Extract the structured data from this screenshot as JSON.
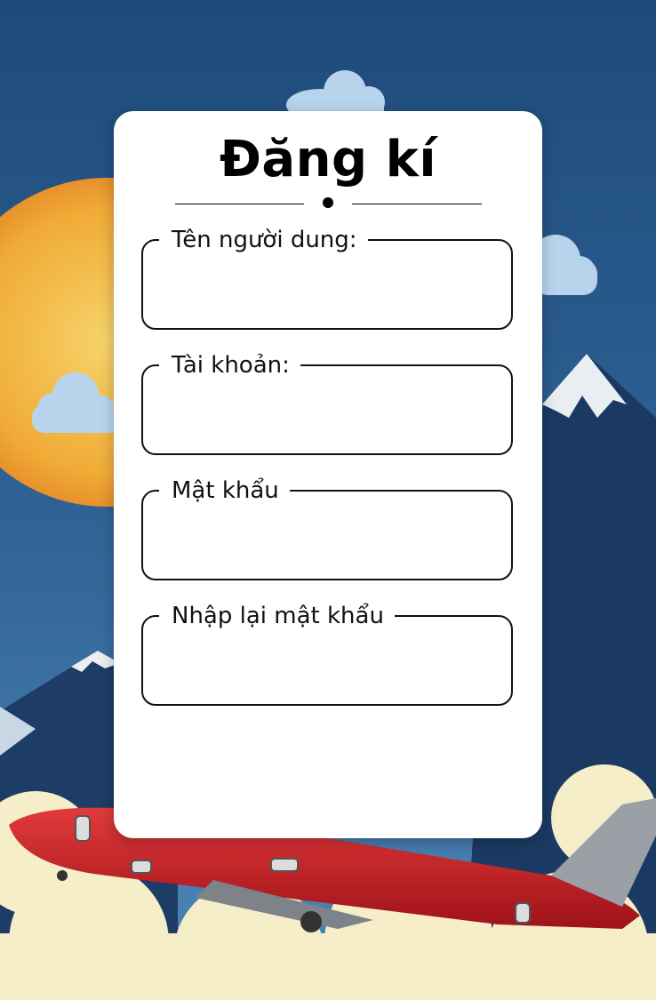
{
  "title": "Đăng kí",
  "fields": [
    {
      "label": "Tên người dung:",
      "value": ""
    },
    {
      "label": "Tài khoản:",
      "value": ""
    },
    {
      "label": "Mật khẩu",
      "value": ""
    },
    {
      "label": "Nhập lại mật khẩu",
      "value": ""
    }
  ],
  "colors": {
    "sky": "#2f5f8f",
    "sun": "#f2b23a",
    "mountain": "#1b3a63",
    "cloud_blue": "#b8d4ec",
    "cloud_cream": "#f6edc9",
    "plane_body": "#c8202a",
    "plane_tail": "#9aa0a6",
    "card": "#ffffff"
  }
}
